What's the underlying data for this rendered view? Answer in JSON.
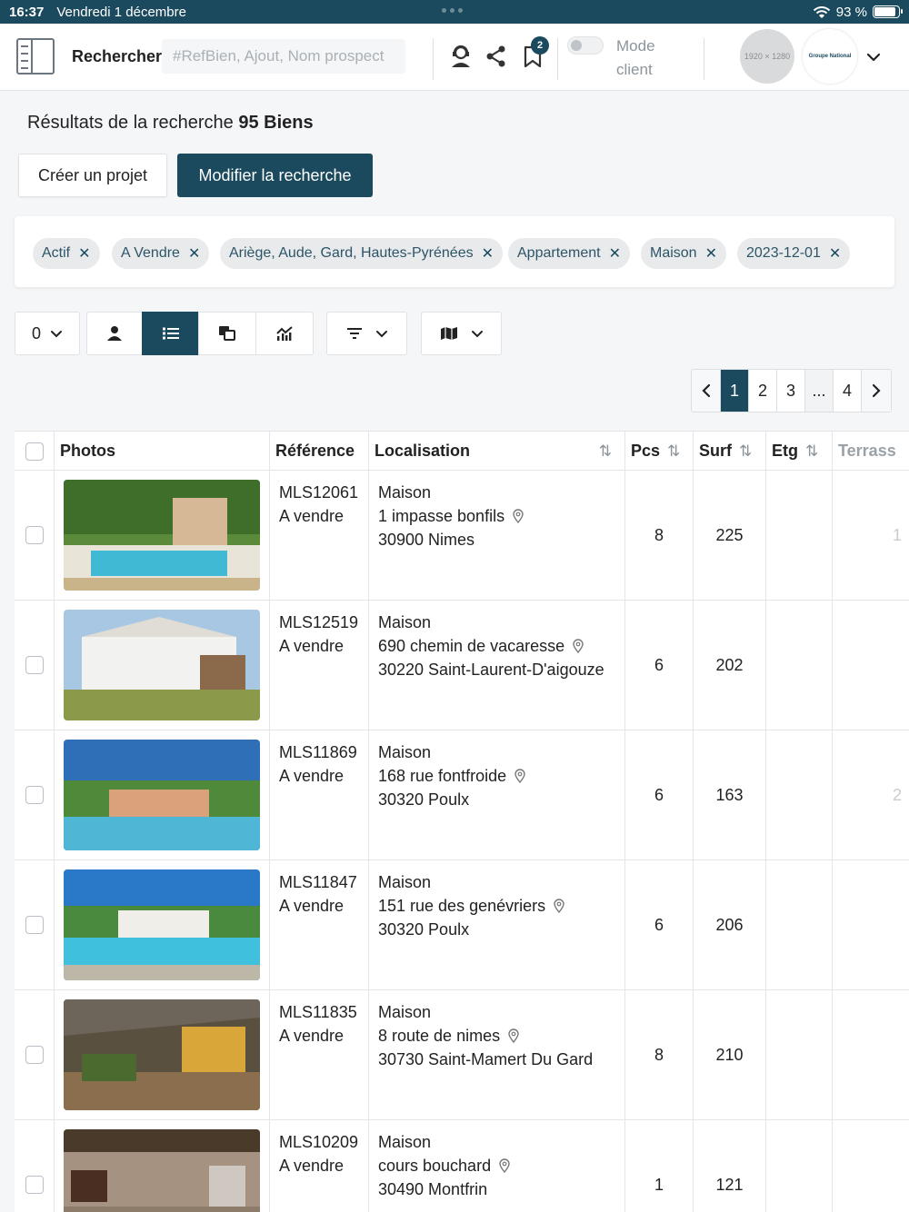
{
  "status": {
    "time": "16:37",
    "date": "Vendredi 1 décembre",
    "battery": "93 %"
  },
  "nav": {
    "search_label": "Rechercher",
    "search_placeholder": "#RefBien, Ajout, Nom prospect",
    "bookmark_count": "2",
    "mode_label": "Mode client",
    "avatar_placeholder": "1920 × 1280",
    "logo_text": "Groupe National"
  },
  "results": {
    "prefix": "Résultats de la recherche",
    "count": "95 Biens"
  },
  "actions": {
    "create_project": "Créer un projet",
    "modify_search": "Modifier la recherche"
  },
  "filters": [
    "Actif",
    "A Vendre",
    "Ariège, Aude, Gard, Hautes-Pyrénées",
    "Appartement",
    "Maison",
    "2023-12-01"
  ],
  "toolbar": {
    "select_count": "0"
  },
  "pagination": {
    "pages": [
      "1",
      "2",
      "3",
      "...",
      "4"
    ],
    "current": "1"
  },
  "table": {
    "columns": [
      "Photos",
      "Référence",
      "Localisation",
      "Pcs",
      "Surf",
      "Etg",
      "Terrass"
    ],
    "rows": [
      {
        "ref": "MLS12061",
        "status": "A vendre",
        "type": "Maison",
        "address": "1 impasse bonfils",
        "city": "30900 Nimes",
        "pcs": "8",
        "surf": "225",
        "etg": "",
        "terrace": "1"
      },
      {
        "ref": "MLS12519",
        "status": "A vendre",
        "type": "Maison",
        "address": "690 chemin de vacaresse",
        "city": "30220 Saint-Laurent-D'aigouze",
        "pcs": "6",
        "surf": "202",
        "etg": "",
        "terrace": ""
      },
      {
        "ref": "MLS11869",
        "status": "A vendre",
        "type": "Maison",
        "address": "168 rue fontfroide",
        "city": "30320 Poulx",
        "pcs": "6",
        "surf": "163",
        "etg": "",
        "terrace": "2"
      },
      {
        "ref": "MLS11847",
        "status": "A vendre",
        "type": "Maison",
        "address": "151 rue des genévriers",
        "city": "30320 Poulx",
        "pcs": "6",
        "surf": "206",
        "etg": "",
        "terrace": ""
      },
      {
        "ref": "MLS11835",
        "status": "A vendre",
        "type": "Maison",
        "address": "8 route de nimes",
        "city": "30730 Saint-Mamert Du Gard",
        "pcs": "8",
        "surf": "210",
        "etg": "",
        "terrace": ""
      },
      {
        "ref": "MLS10209",
        "status": "A vendre",
        "type": "Maison",
        "address": "cours bouchard",
        "city": "30490 Montfrin",
        "pcs": "1",
        "surf": "121",
        "etg": "",
        "terrace": ""
      }
    ]
  },
  "colors": {
    "primary": "#1b4a5e",
    "chip_bg": "#e8eaec",
    "background": "#f5f6f8"
  }
}
